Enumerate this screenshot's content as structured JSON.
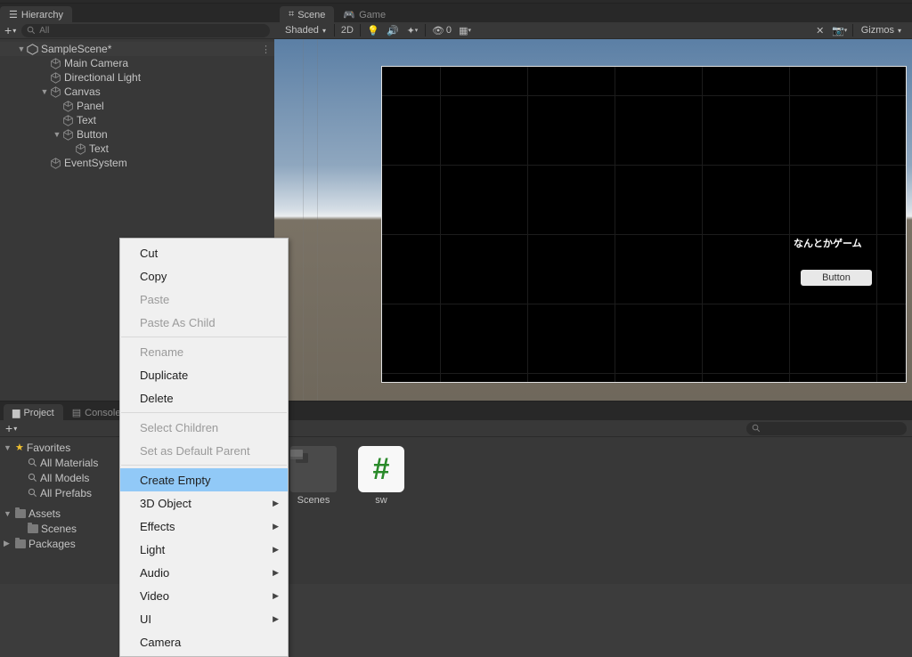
{
  "hierarchy": {
    "tab_label": "Hierarchy",
    "search_placeholder": "All",
    "scene_name": "SampleScene*",
    "items": [
      {
        "label": "Main Camera",
        "indent": 2,
        "fold": ""
      },
      {
        "label": "Directional Light",
        "indent": 2,
        "fold": ""
      },
      {
        "label": "Canvas",
        "indent": 2,
        "fold": "▼"
      },
      {
        "label": "Panel",
        "indent": 3,
        "fold": ""
      },
      {
        "label": "Text",
        "indent": 3,
        "fold": ""
      },
      {
        "label": "Button",
        "indent": 3,
        "fold": "▼"
      },
      {
        "label": "Text",
        "indent": 4,
        "fold": ""
      },
      {
        "label": "EventSystem",
        "indent": 2,
        "fold": ""
      }
    ]
  },
  "scene": {
    "tabs": {
      "scene": "Scene",
      "game": "Game"
    },
    "shading_mode": "Shaded",
    "btn_2d": "2D",
    "hidden_count": "0",
    "gizmos_label": "Gizmos",
    "game_text": "なんとかゲーム",
    "button_label": "Button"
  },
  "context_menu": {
    "items": [
      {
        "label": "Cut",
        "disabled": false,
        "sub": false
      },
      {
        "label": "Copy",
        "disabled": false,
        "sub": false
      },
      {
        "label": "Paste",
        "disabled": true,
        "sub": false
      },
      {
        "label": "Paste As Child",
        "disabled": true,
        "sub": false
      },
      {
        "sep": true
      },
      {
        "label": "Rename",
        "disabled": true,
        "sub": false
      },
      {
        "label": "Duplicate",
        "disabled": false,
        "sub": false
      },
      {
        "label": "Delete",
        "disabled": false,
        "sub": false
      },
      {
        "sep": true
      },
      {
        "label": "Select Children",
        "disabled": true,
        "sub": false
      },
      {
        "label": "Set as Default Parent",
        "disabled": true,
        "sub": false
      },
      {
        "sep": true
      },
      {
        "label": "Create Empty",
        "disabled": false,
        "sub": false,
        "highlight": true
      },
      {
        "label": "3D Object",
        "disabled": false,
        "sub": true
      },
      {
        "label": "Effects",
        "disabled": false,
        "sub": true
      },
      {
        "label": "Light",
        "disabled": false,
        "sub": true
      },
      {
        "label": "Audio",
        "disabled": false,
        "sub": true
      },
      {
        "label": "Video",
        "disabled": false,
        "sub": true
      },
      {
        "label": "UI",
        "disabled": false,
        "sub": true
      },
      {
        "label": "Camera",
        "disabled": false,
        "sub": false
      }
    ]
  },
  "project": {
    "tabs": {
      "project": "Project",
      "console": "Console"
    },
    "favorites_label": "Favorites",
    "fav_items": [
      "All Materials",
      "All Models",
      "All Prefabs"
    ],
    "assets_label": "Assets",
    "assets_children": [
      "Scenes"
    ],
    "packages_label": "Packages",
    "content_items": [
      {
        "label": "Scenes",
        "type": "folder"
      },
      {
        "label": "sw",
        "type": "cs"
      }
    ]
  }
}
